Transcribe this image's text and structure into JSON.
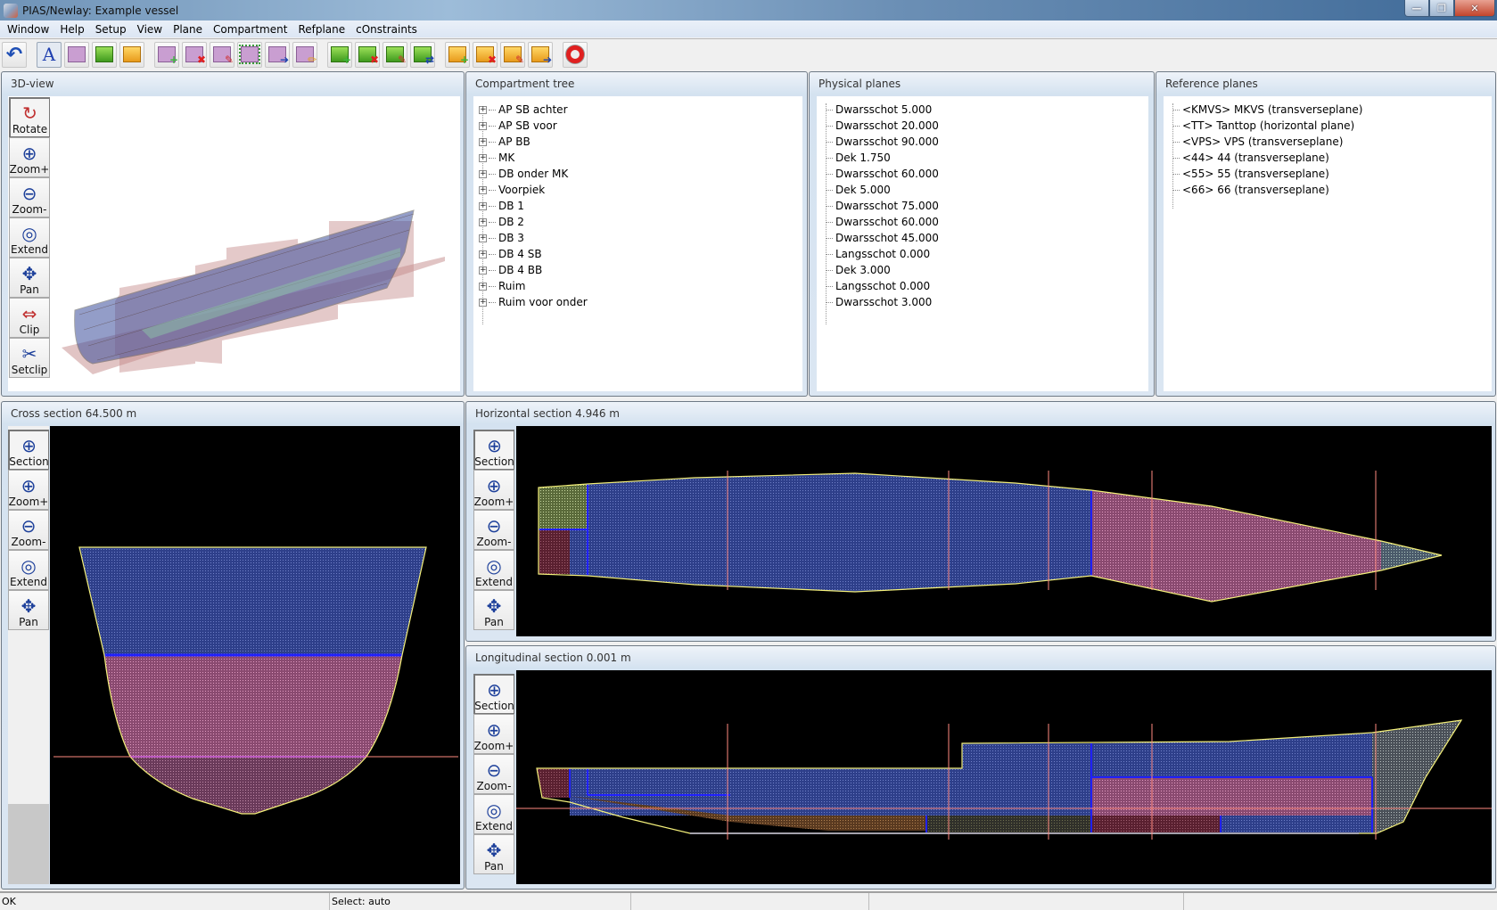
{
  "window": {
    "title": "PIAS/Newlay: Example vessel",
    "controls": {
      "minimize": "—",
      "restore": "❐",
      "close": "✕"
    }
  },
  "menu": [
    "Window",
    "Help",
    "Setup",
    "View",
    "Plane",
    "Compartment",
    "Refplane",
    "cOnstraints"
  ],
  "toolbar": {
    "buttons": [
      {
        "name": "undo-icon"
      },
      {
        "name": "select-text-icon"
      },
      {
        "name": "select-plane-icon"
      },
      {
        "name": "select-compartment-icon"
      },
      {
        "name": "select-refplane-icon"
      },
      {
        "name": "add-plane-icon"
      },
      {
        "name": "delete-plane-icon"
      },
      {
        "name": "edit-plane-icon"
      },
      {
        "name": "resize-plane-icon"
      },
      {
        "name": "move-plane-icon"
      },
      {
        "name": "rename-plane-icon"
      },
      {
        "name": "add-compartment-icon"
      },
      {
        "name": "delete-compartment-icon"
      },
      {
        "name": "edit-compartment-icon"
      },
      {
        "name": "swap-compartment-icon"
      },
      {
        "name": "add-refplane-icon"
      },
      {
        "name": "delete-refplane-icon"
      },
      {
        "name": "edit-refplane-icon"
      },
      {
        "name": "move-refplane-icon"
      },
      {
        "name": "help-lifebuoy-icon"
      }
    ]
  },
  "view3d": {
    "title": "3D-view",
    "tools": [
      "Rotate",
      "Zoom+",
      "Zoom-",
      "Extend",
      "Pan",
      "Clip",
      "Setclip"
    ]
  },
  "compartment_tree": {
    "title": "Compartment tree",
    "items": [
      "AP SB achter",
      "AP SB voor",
      "AP BB",
      "MK",
      "DB onder MK",
      "Voorpiek",
      "DB 1",
      "DB 2",
      "DB 3",
      "DB 4 SB",
      "DB 4 BB",
      "Ruim",
      "Ruim voor onder"
    ]
  },
  "physical_planes": {
    "title": "Physical planes",
    "items": [
      "Dwarsschot 5.000",
      "Dwarsschot 20.000",
      "Dwarsschot 90.000",
      "Dek 1.750",
      "Dwarsschot 60.000",
      "Dek 5.000",
      "Dwarsschot 75.000",
      "Dwarsschot 60.000",
      "Dwarsschot 45.000",
      "Langsschot 0.000",
      "Dek 3.000",
      "Langsschot 0.000",
      "Dwarsschot 3.000"
    ]
  },
  "reference_planes": {
    "title": "Reference planes",
    "items": [
      "<KMVS> MKVS (transverseplane)",
      "<TT> Tanttop (horizontal plane)",
      "<VPS> VPS (transverseplane)",
      "<44> 44 (transverseplane)",
      "<55> 55 (transverseplane)",
      "<66> 66 (transverseplane)"
    ]
  },
  "cross_section": {
    "title": "Cross section 64.500 m",
    "tools": [
      "Section",
      "Zoom+",
      "Zoom-",
      "Extend",
      "Pan"
    ]
  },
  "horizontal_section": {
    "title": "Horizontal section 4.946 m",
    "tools": [
      "Section",
      "Zoom+",
      "Zoom-",
      "Extend",
      "Pan"
    ]
  },
  "longitudinal_section": {
    "title": "Longitudinal section 0.001 m",
    "tools": [
      "Section",
      "Zoom+",
      "Zoom-",
      "Extend",
      "Pan"
    ]
  },
  "statusbar": [
    "OK",
    "Select: auto",
    "",
    "",
    ""
  ],
  "colors": {
    "compartment_blue": "#3a4aa0",
    "compartment_pink": "#b05a86",
    "compartment_green": "#7f9a5a",
    "compartment_grey": "#9aa4ae",
    "compartment_brown": "#8a5a2a",
    "hull_outline": "#f4f07a",
    "plane_line": "#ff8a80",
    "bulkhead_blue": "#2020ff"
  }
}
